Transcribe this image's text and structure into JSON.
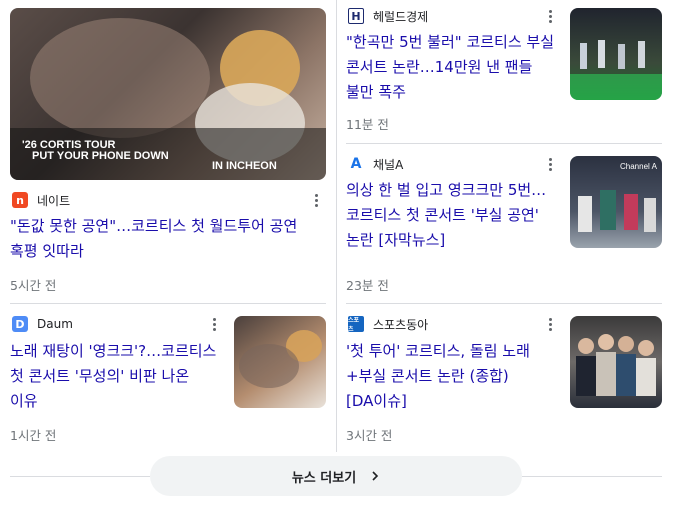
{
  "more_button": {
    "label": "뉴스 더보기",
    "icon": "chevron-right-icon"
  },
  "featured": {
    "image_lines": [
      "'26 CORTIS TOUR",
      "PUT YOUR PHONE DOWN",
      "IN INCHEON"
    ],
    "source": "네이트",
    "source_logo": {
      "text": "n",
      "color": "#f04923",
      "icon": "nate-logo"
    },
    "headline": "\"돈값 못한 공연\"…코르티스 첫 월드투어 공연 혹평 잇따라",
    "time": "5시간 전"
  },
  "left_small": {
    "source": "Daum",
    "source_logo": {
      "text": "D",
      "color": "#4e8cf6",
      "icon": "daum-logo"
    },
    "headline": "노래 재탕이 '영크크'?…코르티스 첫 콘서트 '무성의' 비판 나온 이유",
    "time": "1시간 전"
  },
  "right_items": [
    {
      "source": "헤럴드경제",
      "source_logo": {
        "text": "H",
        "color": "#1d2a6e",
        "icon": "herald-logo"
      },
      "headline": "\"한곡만 5번 불러\" 코르티스 부실 콘서트 논란…14만원 낸 팬들 불만 폭주",
      "time": "11분 전"
    },
    {
      "source": "채널A",
      "source_logo": {
        "text": "A",
        "color": "#1a73e8",
        "icon": "channel-a-logo"
      },
      "headline": "의상 한 벌 입고 영크크만 5번… 코르티스 첫 콘서트 '부실 공연' 논란 [자막뉴스]",
      "time": "23분 전",
      "image_text": "Channel A"
    },
    {
      "source": "스포츠동아",
      "source_logo": {
        "text": "스포츠",
        "color": "#1565c0",
        "icon": "sports-donga-logo"
      },
      "headline": "'첫 투어' 코르티스, 돌림 노래+부실 콘서트 논란 (종합)[DA이슈]",
      "time": "3시간 전"
    }
  ]
}
